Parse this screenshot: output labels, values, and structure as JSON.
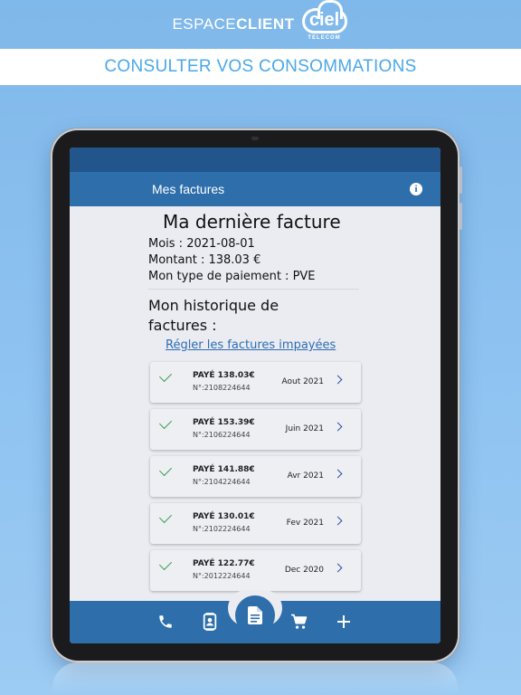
{
  "brand": {
    "espace": "ESPACE",
    "client": "CLIENT",
    "logo": "ciel",
    "logo_sub": "TELECOM"
  },
  "banner": {
    "title": "CONSULTER VOS CONSOMMATIONS"
  },
  "app": {
    "title": "Mes factures",
    "info_icon": "info-icon"
  },
  "last_invoice": {
    "title": "Ma dernière facture",
    "month": "Mois : 2021-08-01",
    "amount": "Montant : 138.03 €",
    "payment_type": "Mon type de paiement : PVE"
  },
  "history": {
    "title": "Mon historique de factures :",
    "pay_link": "Régler les factures impayées",
    "invoices": [
      {
        "status": "PAYÉ 138.03€",
        "number": "N°:2108224644",
        "date": "Aout 2021"
      },
      {
        "status": "PAYÉ 153.39€",
        "number": "N°:2106224644",
        "date": "Juin 2021"
      },
      {
        "status": "PAYÉ 141.88€",
        "number": "N°:2104224644",
        "date": "Avr 2021"
      },
      {
        "status": "PAYÉ 130.01€",
        "number": "N°:2102224644",
        "date": "Fev 2021"
      },
      {
        "status": "PAYÉ 122.77€",
        "number": "N°:2012224644",
        "date": "Dec 2020"
      }
    ]
  },
  "bottom_nav": {
    "items": [
      "phone-icon",
      "contacts-icon",
      "invoice-icon",
      "cart-icon",
      "plus-icon"
    ],
    "active": "invoice-icon"
  },
  "colors": {
    "background": "#8fc3f1",
    "app_bar": "#2e6eaa",
    "status_bar": "#21558c",
    "banner_text": "#4aa8e8",
    "paid_check": "#3a9b56",
    "link": "#2c6db3"
  }
}
